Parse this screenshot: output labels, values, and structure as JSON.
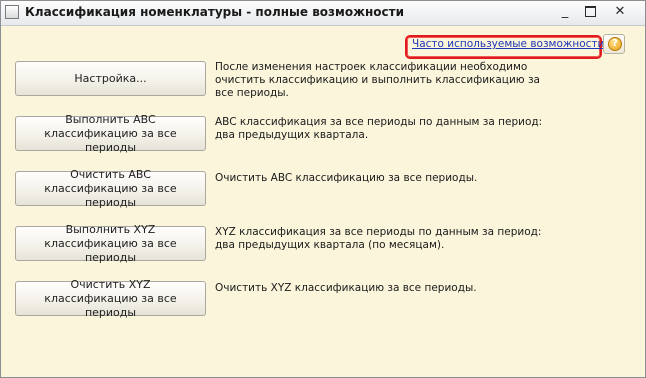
{
  "window": {
    "title": "Классификация номенклатуры - полные возможности",
    "minimize_glyph": "_",
    "close_glyph": "✕"
  },
  "toolbar": {
    "frequent_link": "Часто используемые возможности",
    "help_glyph": "?"
  },
  "actions": [
    {
      "button": "Настройка...",
      "description": "После изменения настроек классификации необходимо очистить классификацию и выполнить классификацию за все периоды."
    },
    {
      "button": "Выполнить ABC классификацию за все периоды",
      "description": "ABC классификация за все периоды по данным за период: два предыдущих квартала."
    },
    {
      "button": "Очистить ABC классификацию за все периоды",
      "description": "Очистить ABC классификацию за все периоды."
    },
    {
      "button": "Выполнить XYZ классификацию за все периоды",
      "description": "XYZ классификация за все периоды по данным за период: два предыдущих квартала (по месяцам)."
    },
    {
      "button": "Очистить XYZ классификацию за все периоды",
      "description": "Очистить XYZ классификацию за все периоды."
    }
  ],
  "colors": {
    "form_background": "#fbf5dc",
    "link": "#1f37b5",
    "highlight": "#e21c1c"
  }
}
